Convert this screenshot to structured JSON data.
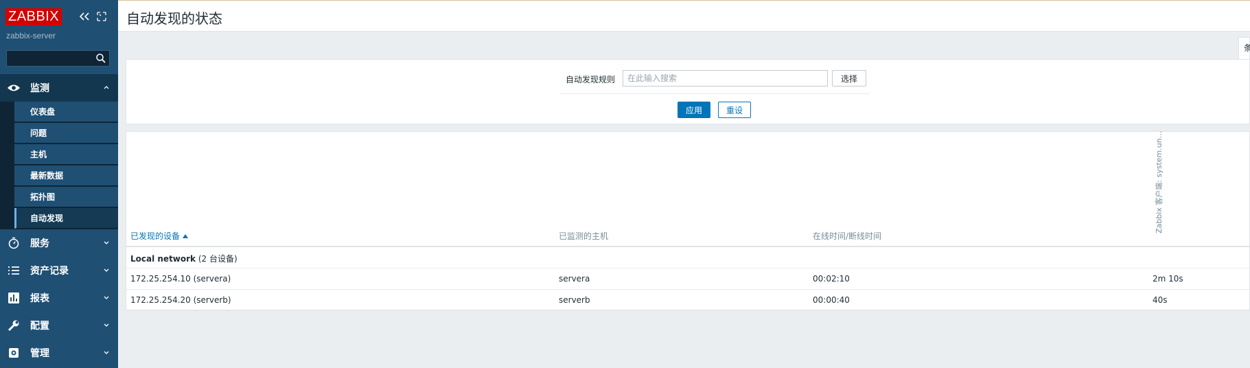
{
  "app": {
    "logo": "ZABBIX",
    "server_name": "zabbix-server",
    "search_placeholder": ""
  },
  "sidebar": {
    "monitoring": {
      "label": "监测",
      "icon": "eye-icon",
      "items": [
        {
          "label": "仪表盘"
        },
        {
          "label": "问题"
        },
        {
          "label": "主机"
        },
        {
          "label": "最新数据"
        },
        {
          "label": "拓扑图"
        },
        {
          "label": "自动发现",
          "active": true
        }
      ]
    },
    "sections": [
      {
        "label": "服务",
        "icon": "stopwatch-icon"
      },
      {
        "label": "资产记录",
        "icon": "list-icon"
      },
      {
        "label": "报表",
        "icon": "bar-chart-icon"
      },
      {
        "label": "配置",
        "icon": "wrench-icon"
      },
      {
        "label": "管理",
        "icon": "gear-icon"
      }
    ]
  },
  "page": {
    "title": "自动发现的状态",
    "filter_tab_label": "条"
  },
  "filter": {
    "rule_label": "自动发现规则",
    "rule_placeholder": "在此输入搜索",
    "select_label": "选择",
    "apply_label": "应用",
    "reset_label": "重设"
  },
  "table": {
    "columns": {
      "device": "已发现的设备",
      "host": "已监测的主机",
      "uptime": "在线时间/断线时间",
      "check": "Zabbix 客户端: system.un..."
    },
    "group": {
      "name": "Local network",
      "count": "(2 台设备)"
    },
    "rows": [
      {
        "device": "172.25.254.10 (servera)",
        "host": "servera",
        "uptime": "00:02:10",
        "check": "2m 10s"
      },
      {
        "device": "172.25.254.20 (serverb)",
        "host": "serverb",
        "uptime": "00:00:40",
        "check": "40s"
      }
    ]
  },
  "colors": {
    "sidebar": "#1f4f73",
    "logo_red": "#d40000",
    "accent": "#0275b8"
  }
}
